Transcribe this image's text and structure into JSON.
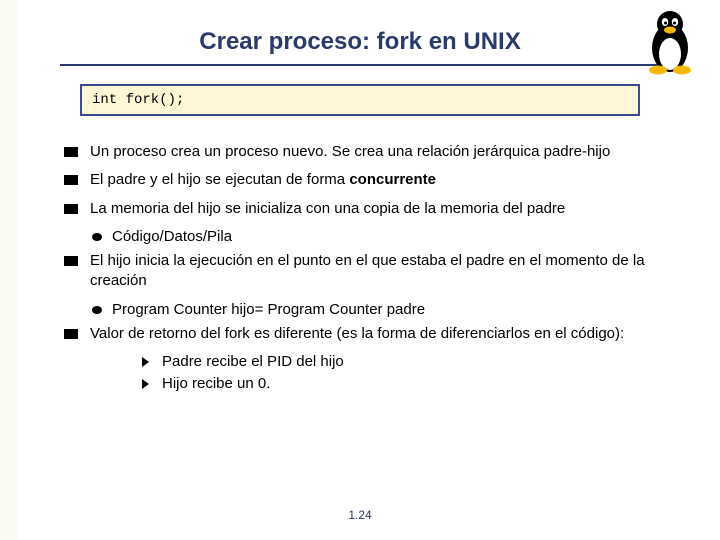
{
  "title": "Crear proceso: fork en UNIX",
  "code": "int fork();",
  "mascot_name": "tux-penguin",
  "items": {
    "i0": {
      "pre": "Un proceso crea un proceso nuevo. Se crea una relación jerárquica padre-hijo"
    },
    "i1": {
      "pre": "El padre y el hijo se ejecutan de forma ",
      "bold": "concurrente"
    },
    "i2": {
      "pre": "La memoria del hijo se inicializa con una copia de la memoria del padre",
      "sub": {
        "s0": "Código/Datos/Pila"
      }
    },
    "i3": {
      "pre": "El hijo inicia la ejecución en el punto en el que estaba el padre en el momento de la creación",
      "sub": {
        "s0": "Program Counter hijo= Program Counter padre"
      }
    },
    "i4": {
      "pre": "Valor de retorno del fork es diferente (es la forma de diferenciarlos en el código):",
      "sub3": {
        "t0": "Padre recibe el PID del hijo",
        "t1": "Hijo recibe un 0."
      }
    }
  },
  "pagenum": "1.24"
}
